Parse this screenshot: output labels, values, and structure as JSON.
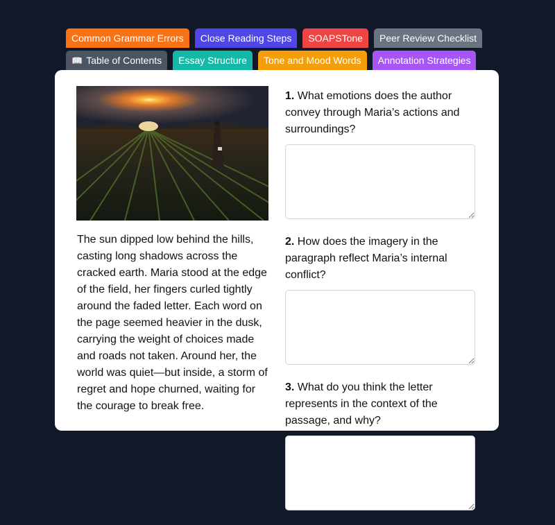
{
  "tabs_row1": [
    {
      "label": "Common Grammar Errors",
      "color": "#f97316"
    },
    {
      "label": "Close Reading Steps",
      "color": "#4f46e5"
    },
    {
      "label": "SOAPSTone",
      "color": "#ef4444"
    },
    {
      "label": "Peer Review Checklist",
      "color": "#6b7280"
    }
  ],
  "tabs_row2": [
    {
      "label": "Table of Contents",
      "color": "#4b5563",
      "icon": "book-icon"
    },
    {
      "label": "Essay Structure",
      "color": "#14b8a6"
    },
    {
      "label": "Tone and Mood Words",
      "color": "#f59e0b"
    },
    {
      "label": "Annotation Strategies",
      "color": "#a855f7"
    }
  ],
  "image": {
    "subject": "woman standing in a plowed field at sunset holding a letter"
  },
  "passage": "The sun dipped low behind the hills, casting long shadows across the cracked earth. Maria stood at the edge of the field, her fingers curled tightly around the faded letter. Each word on the page seemed heavier in the dusk, carrying the weight of choices made and roads not taken. Around her, the world was quiet—but inside, a storm of regret and hope churned, waiting for the courage to break free.",
  "questions": [
    {
      "number": "1.",
      "text": "What emotions does the author convey through Maria’s actions and surroundings?",
      "answer": ""
    },
    {
      "number": "2.",
      "text": "How does the imagery in the paragraph reflect Maria’s internal conflict?",
      "answer": ""
    },
    {
      "number": "3.",
      "text": "What do you think the letter represents in the context of the passage, and why?",
      "answer": ""
    }
  ]
}
